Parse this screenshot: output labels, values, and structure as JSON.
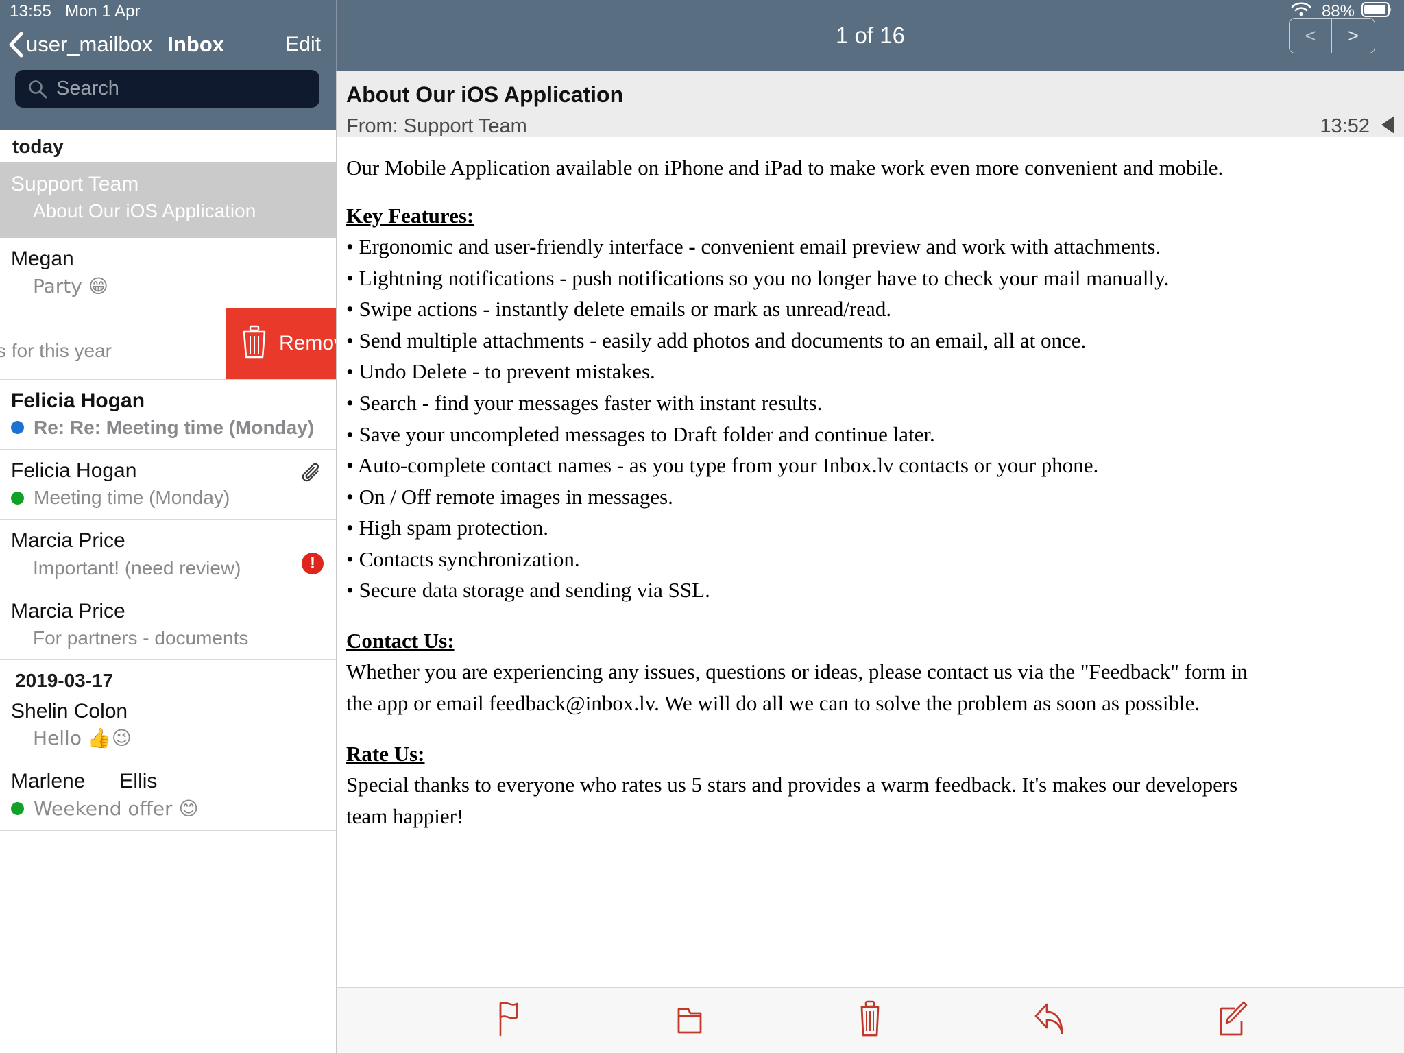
{
  "status_bar": {
    "time": "13:55",
    "date": "Mon 1 Apr",
    "battery_percent": "88%",
    "wifi_icon": "wifi-icon",
    "battery_icon": "battery-icon"
  },
  "sidebar": {
    "back_label": "user_mailbox",
    "title": "Inbox",
    "edit_label": "Edit",
    "search": {
      "placeholder": "Search",
      "value": ""
    },
    "groups": [
      {
        "header": "today",
        "messages": [
          {
            "sender": "Support Team",
            "subject": "About Our iOS Application",
            "selected": true,
            "unread_dot": "",
            "bold": false,
            "attachment": false,
            "alert": false
          },
          {
            "sender": "Megan",
            "subject": "Party 😁",
            "selected": false,
            "unread_dot": "",
            "bold": false,
            "attachment": false,
            "alert": false
          },
          {
            "sender": "",
            "subject": "ents for this year",
            "selected": false,
            "unread_dot": "",
            "bold": false,
            "attachment": true,
            "alert": true,
            "swiped": true,
            "swipe_action": "Remove",
            "swipe_icon": "trash-icon"
          },
          {
            "sender": "Felicia Hogan",
            "subject": "Re: Re: Meeting time (Monday)",
            "selected": false,
            "unread_dot": "blue",
            "bold": true,
            "attachment": false,
            "alert": false
          },
          {
            "sender": "Felicia Hogan",
            "subject": "Meeting time (Monday)",
            "selected": false,
            "unread_dot": "green",
            "bold": false,
            "attachment": true,
            "alert": false
          },
          {
            "sender": "Marcia Price",
            "subject": "Important! (need review)",
            "selected": false,
            "unread_dot": "",
            "bold": false,
            "attachment": false,
            "alert": true
          },
          {
            "sender": "Marcia Price",
            "subject": "For partners - documents",
            "selected": false,
            "unread_dot": "",
            "bold": false,
            "attachment": false,
            "alert": false
          }
        ]
      },
      {
        "header": "2019-03-17",
        "messages": [
          {
            "sender": "Shelin Colon",
            "subject": "Hello 👍😉",
            "selected": false,
            "unread_dot": "",
            "bold": false,
            "attachment": false,
            "alert": false
          },
          {
            "sender": "Marlene      Ellis",
            "subject": "Weekend offer 😊",
            "selected": false,
            "unread_dot": "green",
            "bold": false,
            "attachment": false,
            "alert": false
          }
        ]
      }
    ]
  },
  "reader": {
    "counter": "1 of 16",
    "prev_label": "<",
    "next_label": ">",
    "subject": "About Our iOS Application",
    "from": "From: Support Team",
    "time": "13:52",
    "detail_arrow_icon": "triangle-left-icon",
    "body": {
      "intro": "Our Mobile Application available on iPhone and iPad to make work even more convenient and mobile.",
      "features_heading": "Key Features:",
      "features": [
        "• Ergonomic and user-friendly interface - convenient email preview and work with attachments.",
        "• Lightning notifications - push notifications so you no longer have to check your mail manually.",
        "• Swipe actions - instantly delete emails or mark as unread/read.",
        "• Send multiple attachments - easily add photos and documents to an email, all at once.",
        "• Undo Delete - to prevent mistakes.",
        "• Search - find your messages faster with instant results.",
        "• Save your uncompleted messages to Draft folder and continue later.",
        "• Auto-complete contact names - as you type from your Inbox.lv contacts or your phone.",
        "• On / Off remote images in messages.",
        "• High spam protection.",
        "• Contacts synchronization.",
        "• Secure data storage and sending via SSL."
      ],
      "contact_heading": "Contact Us: ",
      "contact_line1": "Whether you are experiencing any issues, questions or ideas, please contact us via the \"Feedback\" form in",
      "contact_line2": "the app or email feedback@inbox.lv. We will do all we can to solve the problem as soon as possible.",
      "rate_heading": "Rate Us:",
      "rate_line1": "Special thanks to everyone who rates us 5 stars and provides a warm feedback. It's makes our developers",
      "rate_line2": "team happier!"
    }
  },
  "toolbar": {
    "accent_color": "#c0392b",
    "items": [
      {
        "name": "flag-icon",
        "label": "Flag"
      },
      {
        "name": "folder-icon",
        "label": "Move to folder"
      },
      {
        "name": "trash-icon",
        "label": "Delete"
      },
      {
        "name": "reply-icon",
        "label": "Reply"
      },
      {
        "name": "compose-icon",
        "label": "Compose"
      }
    ]
  },
  "colors": {
    "nav_bar": "#5a6e81",
    "search_field": "#0f1a2e",
    "selected_row": "#cacaca",
    "swipe_remove": "#e8392b",
    "unread_blue": "#1b72d2",
    "unread_green": "#12a128",
    "alert_red": "#e0261c"
  }
}
